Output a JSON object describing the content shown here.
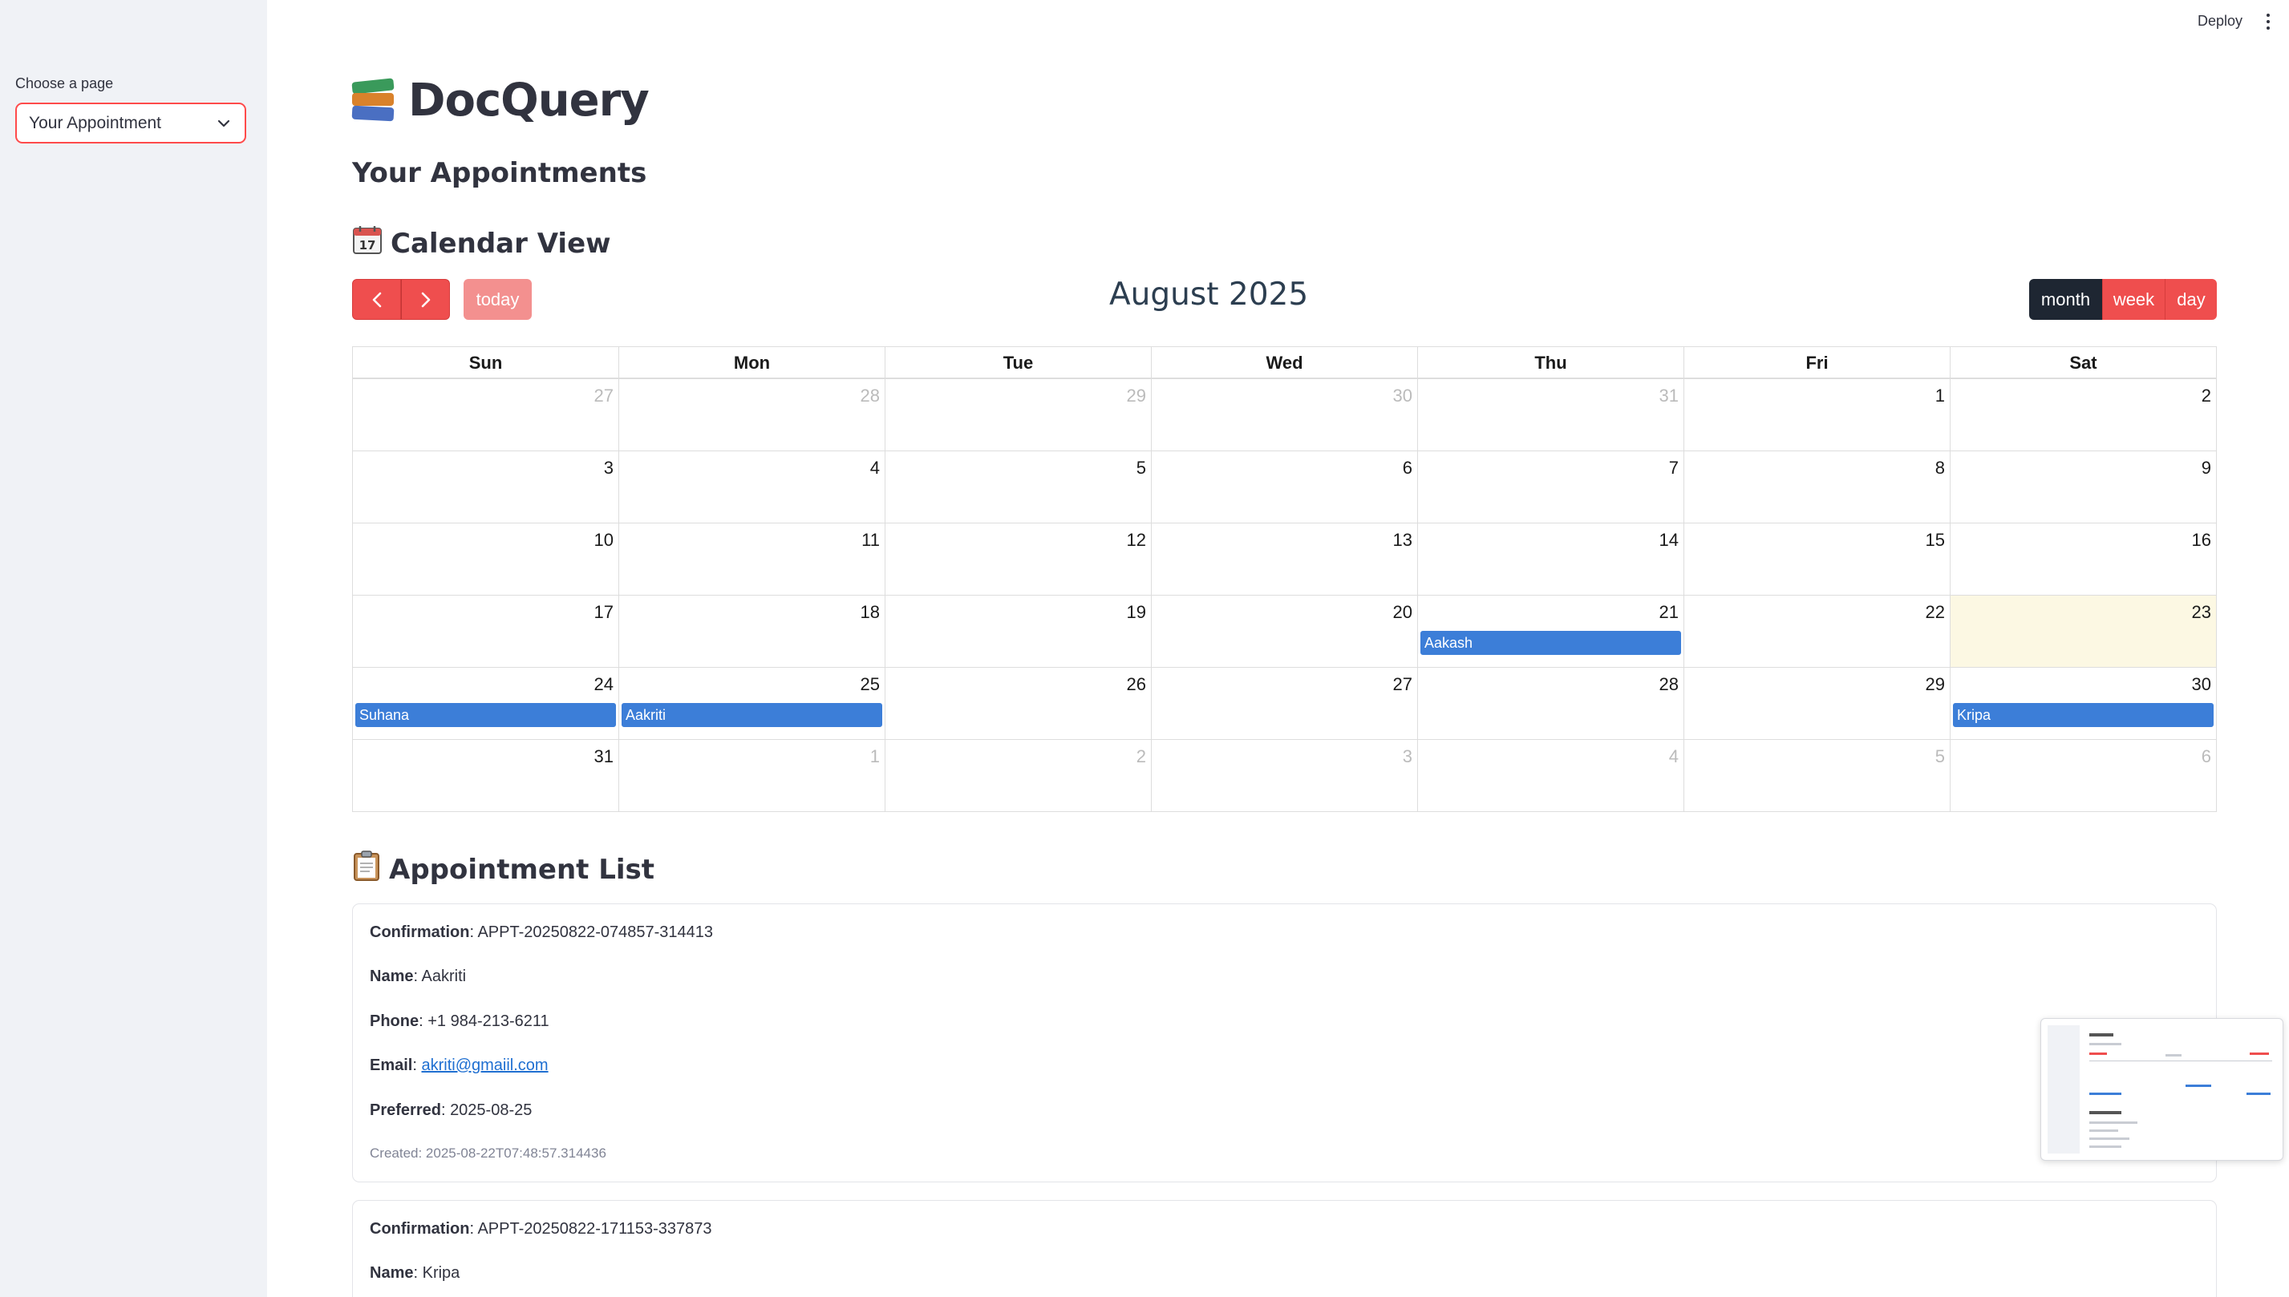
{
  "sidebar": {
    "label": "Choose a page",
    "selected_page": "Your Appointment"
  },
  "header": {
    "deploy_label": "Deploy"
  },
  "app": {
    "title": "DocQuery",
    "subtitle": "Your Appointments"
  },
  "calendar_section": {
    "heading": "Calendar View",
    "icon": "calendar-icon"
  },
  "calendar": {
    "title": "August 2025",
    "today_label": "today",
    "views": [
      "month",
      "week",
      "day"
    ],
    "active_view": "month",
    "weekdays": [
      "Sun",
      "Mon",
      "Tue",
      "Wed",
      "Thu",
      "Fri",
      "Sat"
    ],
    "weeks": [
      [
        {
          "d": "27",
          "o": true
        },
        {
          "d": "28",
          "o": true
        },
        {
          "d": "29",
          "o": true
        },
        {
          "d": "30",
          "o": true
        },
        {
          "d": "31",
          "o": true
        },
        {
          "d": "1"
        },
        {
          "d": "2"
        }
      ],
      [
        {
          "d": "3"
        },
        {
          "d": "4"
        },
        {
          "d": "5"
        },
        {
          "d": "6"
        },
        {
          "d": "7"
        },
        {
          "d": "8"
        },
        {
          "d": "9"
        }
      ],
      [
        {
          "d": "10"
        },
        {
          "d": "11"
        },
        {
          "d": "12"
        },
        {
          "d": "13"
        },
        {
          "d": "14"
        },
        {
          "d": "15"
        },
        {
          "d": "16"
        }
      ],
      [
        {
          "d": "17"
        },
        {
          "d": "18"
        },
        {
          "d": "19"
        },
        {
          "d": "20"
        },
        {
          "d": "21",
          "event": "Aakash"
        },
        {
          "d": "22"
        },
        {
          "d": "23",
          "today": true
        }
      ],
      [
        {
          "d": "24",
          "event": "Suhana"
        },
        {
          "d": "25",
          "event": "Aakriti"
        },
        {
          "d": "26"
        },
        {
          "d": "27"
        },
        {
          "d": "28"
        },
        {
          "d": "29"
        },
        {
          "d": "30",
          "event": "Kripa"
        }
      ],
      [
        {
          "d": "31"
        },
        {
          "d": "1",
          "o": true
        },
        {
          "d": "2",
          "o": true
        },
        {
          "d": "3",
          "o": true
        },
        {
          "d": "4",
          "o": true
        },
        {
          "d": "5",
          "o": true
        },
        {
          "d": "6",
          "o": true
        }
      ]
    ]
  },
  "list_section": {
    "heading": "Appointment List",
    "icon": "clipboard-icon"
  },
  "appointments": [
    {
      "confirmation_label": "Confirmation",
      "confirmation": "APPT-20250822-074857-314413",
      "name_label": "Name",
      "name": "Aakriti",
      "phone_label": "Phone",
      "phone": "+1 984-213-6211",
      "email_label": "Email",
      "email": "akriti@gmaiil.com",
      "preferred_label": "Preferred",
      "preferred": "2025-08-25",
      "created": "Created: 2025-08-22T07:48:57.314436"
    },
    {
      "confirmation_label": "Confirmation",
      "confirmation": "APPT-20250822-171153-337873",
      "name_label": "Name",
      "name": "Kripa"
    }
  ],
  "colors": {
    "accent": "#ef4e4e",
    "event": "#3c7ed8",
    "today_highlight": "#fcf8e3",
    "active_view": "#1e2632"
  }
}
